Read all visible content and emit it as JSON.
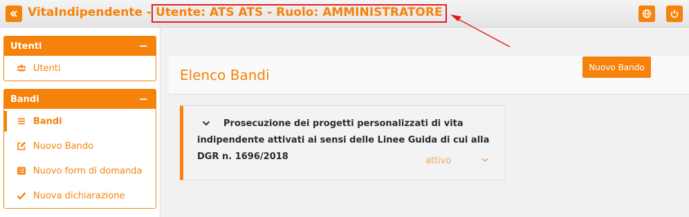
{
  "header": {
    "app_title": "VitaIndipendente -",
    "user_role": "Utente: ATS ATS - Ruolo: AMMINISTRATORE",
    "collapse_icon": "double-chevron-left-icon",
    "globe_icon": "globe-icon",
    "power_icon": "power-icon"
  },
  "sidebar": {
    "panels": [
      {
        "title": "Utenti",
        "toggle": "−",
        "items": [
          {
            "label": "Utenti",
            "icon": "users-icon"
          }
        ]
      },
      {
        "title": "Bandi",
        "toggle": "−",
        "items": [
          {
            "label": "Bandi",
            "icon": "list-icon",
            "active": true
          },
          {
            "label": "Nuovo Bando",
            "icon": "edit-icon"
          },
          {
            "label": "Nuovo form di domanda",
            "icon": "form-list-icon"
          },
          {
            "label": "Nuova dichiarazione",
            "icon": "check-icon"
          }
        ]
      }
    ]
  },
  "main": {
    "title": "Elenco Bandi",
    "new_button": "Nuovo Bando",
    "bandi": [
      {
        "title": "Prosecuzione dei progetti personalizzati di vita indipendente attivati ai sensi delle Linee Guida di cui alla DGR n. 1696/2018",
        "status": "attivo"
      }
    ]
  },
  "colors": {
    "accent": "#f5820b",
    "highlight_border": "#e31b23"
  }
}
